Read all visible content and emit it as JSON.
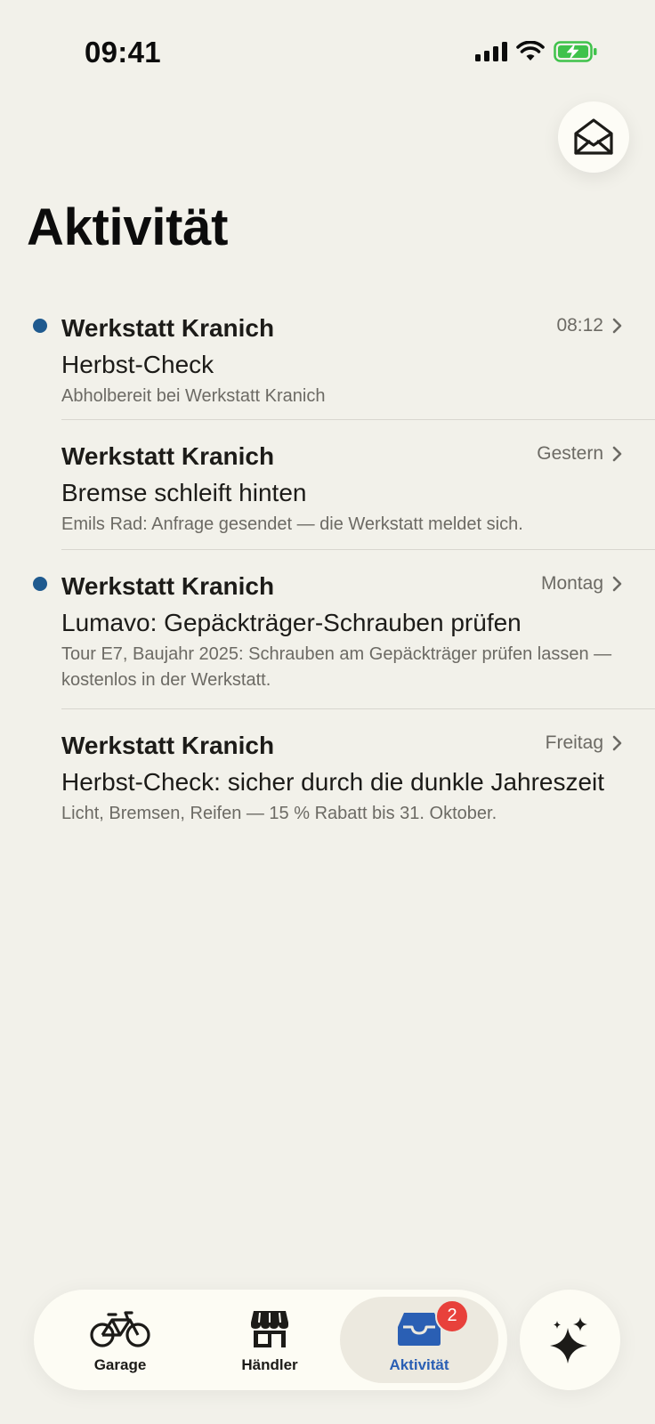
{
  "status_bar": {
    "time": "09:41"
  },
  "header": {
    "title": "Aktivität",
    "mail_icon": "envelope-open-icon"
  },
  "activities": [
    {
      "unread": true,
      "sender": "Werkstatt Kranich",
      "time": "08:12",
      "subject": "Herbst-Check",
      "preview": "Abholbereit bei Werkstatt Kranich"
    },
    {
      "unread": false,
      "sender": "Werkstatt Kranich",
      "time": "Gestern",
      "subject": "Bremse schleift hinten",
      "preview": "Emils Rad: Anfrage gesendet — die Werkstatt meldet sich."
    },
    {
      "unread": true,
      "sender": "Werkstatt Kranich",
      "time": "Montag",
      "subject": "Lumavo: Gepäckträger-Schrauben prüfen",
      "preview": "Tour E7, Baujahr 2025: Schrauben am Gepäckträger prüfen lassen — kostenlos in der Werkstatt."
    },
    {
      "unread": false,
      "sender": "Werkstatt Kranich",
      "time": "Freitag",
      "subject": "Herbst-Check: sicher durch die dunkle Jahres­zeit",
      "preview": "Licht, Bremsen, Reifen — 15 % Rabatt bis 31. Oktober."
    }
  ],
  "tab_bar": {
    "tabs": [
      {
        "label": "Garage",
        "icon": "bicycle-icon"
      },
      {
        "label": "Händler",
        "icon": "store-icon"
      },
      {
        "label": "Aktivität",
        "icon": "inbox-icon",
        "badge": "2",
        "active": true
      }
    ],
    "assistant_icon": "sparkle-icon"
  },
  "colors": {
    "background": "#f2f1ea",
    "unread_dot": "#1f5a8f",
    "active_tab": "#2a5fb4",
    "badge": "#e8413b",
    "battery": "#3fc24b"
  }
}
